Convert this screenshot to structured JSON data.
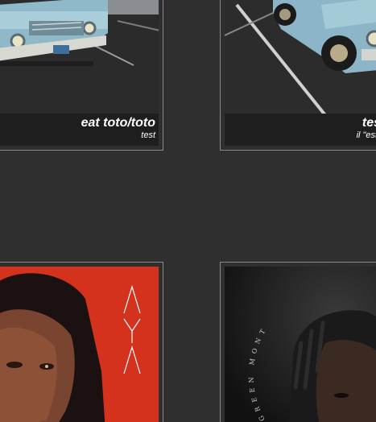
{
  "albums": [
    {
      "title": "eat toto/toto",
      "subtitle": "test",
      "cover": "blue-vintage-truck-photo"
    },
    {
      "title": "tes",
      "subtitle": "il \"est\"",
      "cover": "blue-vintage-truck-photo"
    },
    {
      "title": "",
      "subtitle": "",
      "cover": "portrait-red-background"
    },
    {
      "title": "",
      "subtitle": "",
      "cover": "portrait-dark-background",
      "cover_text": "GREEN MONT"
    }
  ],
  "colors": {
    "background": "#2f2f2f",
    "card_border": "#8a8a8a",
    "caption_bg": "#1e1e1e",
    "caption_text": "#ffffff",
    "red_cover": "#d5321e"
  }
}
